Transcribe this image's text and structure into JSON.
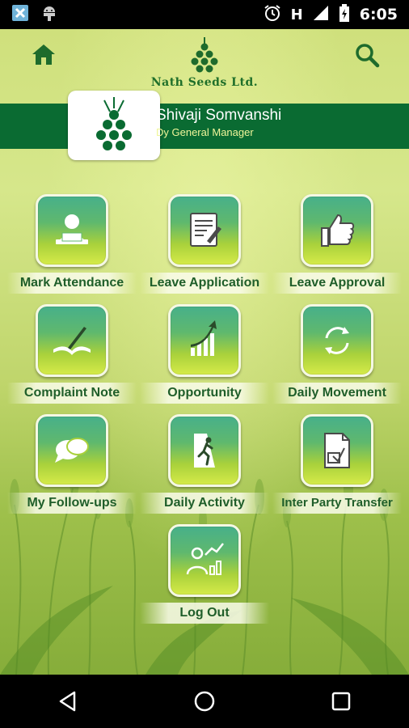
{
  "status_bar": {
    "time": "6:05",
    "network_letter": "H",
    "icons": [
      "notification-x-icon",
      "android-debug-icon",
      "alarm-icon",
      "signal-icon",
      "battery-charging-icon"
    ]
  },
  "header": {
    "brand": "Nath Seeds Ltd.",
    "logo_icon": "seed-cluster-logo-icon",
    "home_icon": "home-icon",
    "search_icon": "search-icon"
  },
  "profile": {
    "name": "Shivaji Somvanshi",
    "role": "Dy General Manager"
  },
  "menu": [
    {
      "label": "Mark Attendance",
      "icon": "user-at-laptop-icon"
    },
    {
      "label": "Leave Application",
      "icon": "document-pen-icon"
    },
    {
      "label": "Leave Approval",
      "icon": "thumbs-up-icon"
    },
    {
      "label": "Complaint Note",
      "icon": "book-pen-icon"
    },
    {
      "label": "Opportunity",
      "icon": "growth-arrow-icon"
    },
    {
      "label": "Daily Movement",
      "icon": "refresh-arrows-icon"
    },
    {
      "label": "My Follow-ups",
      "icon": "chat-bubbles-icon"
    },
    {
      "label": "Daily Activity",
      "icon": "climber-icon"
    },
    {
      "label": "Inter Party Transfer",
      "icon": "transfer-document-icon"
    },
    {
      "label": "Log Out",
      "icon": "analyst-chart-icon"
    }
  ],
  "colors": {
    "brand_green": "#0a6b32",
    "label_text": "#1f5e2a",
    "role_text": "#f0f59a"
  }
}
